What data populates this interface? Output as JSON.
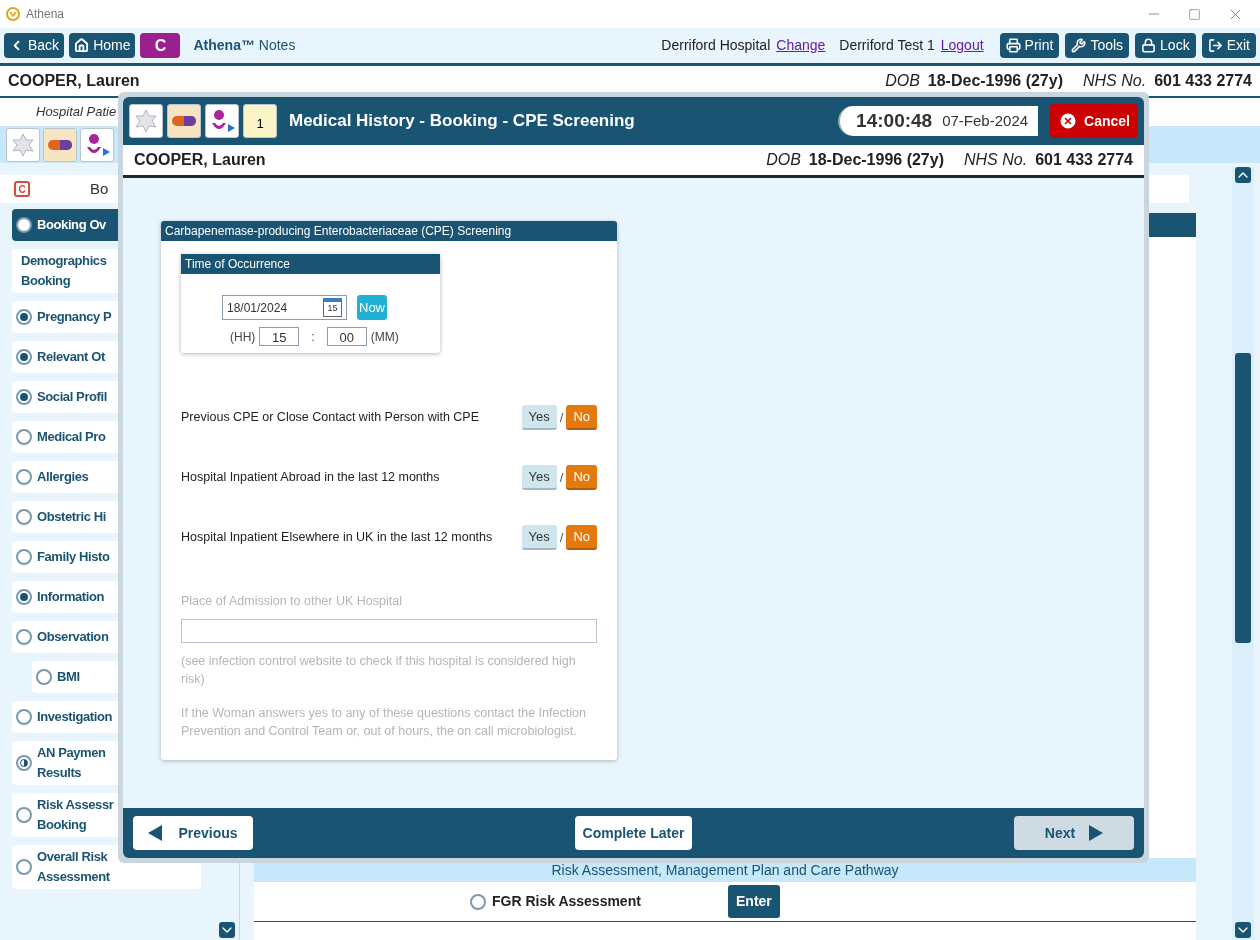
{
  "window": {
    "app_name": "Athena"
  },
  "toolbar": {
    "nav": [
      {
        "label": "Back",
        "kind": "back"
      },
      {
        "label": "Home",
        "kind": "home"
      }
    ],
    "badge": "C",
    "app_title": "**Athena™** Notes",
    "hospital": "Derriford Hospital",
    "change_link": "Change",
    "user": "Derriford Test 1",
    "logout_link": "Logout",
    "actions": [
      {
        "label": "Print",
        "kind": "print"
      },
      {
        "label": "Tools",
        "kind": "tools"
      },
      {
        "label": "Lock",
        "kind": "lock"
      },
      {
        "label": "Exit",
        "kind": "exit"
      }
    ]
  },
  "patient": {
    "name": "COOPER, Lauren",
    "dob_label": "DOB",
    "dob": "18-Dec-1996 (27y)",
    "nhs_label": "NHS No.",
    "nhs": "601 433 2774"
  },
  "subheader": "Hospital Patie",
  "icon_row": [
    {
      "kind": "star"
    },
    {
      "kind": "pill"
    },
    {
      "kind": "person"
    }
  ],
  "sidebar": {
    "badge": "C",
    "header": "Bo",
    "items": [
      {
        "label": "Booking Ov",
        "kind": "empty",
        "selected": true
      },
      {
        "label": "Demographics\nBooking",
        "kind": "plain",
        "selected": false
      },
      {
        "label": "Pregnancy P",
        "kind": "complete",
        "selected": false
      },
      {
        "label": "Relevant Ot",
        "kind": "complete",
        "selected": false
      },
      {
        "label": "Social Profil",
        "kind": "complete",
        "selected": false
      },
      {
        "label": "Medical Pro",
        "kind": "empty",
        "selected": false
      },
      {
        "label": "Allergies",
        "kind": "empty",
        "selected": false
      },
      {
        "label": "Obstetric Hi",
        "kind": "empty",
        "selected": false
      },
      {
        "label": "Family Histo",
        "kind": "empty",
        "selected": false
      },
      {
        "label": "Information",
        "kind": "complete",
        "selected": false
      },
      {
        "label": "Observation",
        "kind": "empty",
        "selected": false,
        "children": [
          {
            "label": "BMI",
            "kind": "empty",
            "selected": false
          }
        ]
      },
      {
        "label": "Investigation",
        "kind": "empty",
        "selected": false
      },
      {
        "label": "AN Paymen\nResults",
        "kind": "partial",
        "selected": false
      },
      {
        "label": "Risk Assessr\nBooking",
        "kind": "empty",
        "selected": false
      },
      {
        "label": "Overall Risk\nAssessment",
        "kind": "empty",
        "selected": false
      }
    ]
  },
  "content": {
    "band": "Risk Assessment, Management Plan and Care Pathway",
    "rows": [
      {
        "label": "FGR Risk Assessment",
        "kind": "empty",
        "button": "Enter"
      }
    ]
  },
  "dialog": {
    "header_icons": [
      {
        "kind": "star"
      },
      {
        "kind": "pill"
      },
      {
        "kind": "person"
      },
      {
        "kind": "notepad",
        "text": "1"
      }
    ],
    "title": "Medical History - Booking - CPE Screening",
    "time": "14:00:48",
    "date": "07-Feb-2024",
    "cancel": "Cancel",
    "patient": {
      "name": "COOPER, Lauren",
      "dob_label": "DOB",
      "dob": "18-Dec-1996 (27y)",
      "nhs_label": "NHS No.",
      "nhs": "601 433 2774"
    },
    "section": {
      "title": "Carbapenemase-producing Enterobacteriaceae (CPE) Screening",
      "occurrence": {
        "title": "Time of Occurrence",
        "date": "18/01/2024",
        "calendar_day": "15",
        "now": "Now",
        "hh_label": "(HH)",
        "hh": "15",
        "separator": ":",
        "mm": "00",
        "mm_label": "(MM)"
      },
      "questions": [
        {
          "text": "Previous CPE or Close Contact with Person with CPE",
          "separator": "/",
          "options": [
            {
              "label": "Yes",
              "selected": false
            },
            {
              "label": "No",
              "selected": true
            }
          ]
        },
        {
          "text": "Hospital Inpatient Abroad in the last 12 months",
          "separator": "/",
          "options": [
            {
              "label": "Yes",
              "selected": false
            },
            {
              "label": "No",
              "selected": true
            }
          ]
        },
        {
          "text": "Hospital Inpatient Elsewhere in UK in the last 12 months",
          "separator": "/",
          "options": [
            {
              "label": "Yes",
              "selected": false
            },
            {
              "label": "No",
              "selected": true
            }
          ]
        }
      ],
      "admission": {
        "label": "Place of Admission to other UK Hospital",
        "disabled": true
      },
      "notes": [
        "(see infection control website to check if this hospital is considered high risk)",
        "If the Woman answers yes to any of these questions contact the Infection Prevention and Control Team or, out of hours, the on call microbiologist."
      ]
    },
    "footer": {
      "previous": "Previous",
      "complete_later": "Complete Later",
      "next": "Next",
      "next_disabled": true
    }
  }
}
